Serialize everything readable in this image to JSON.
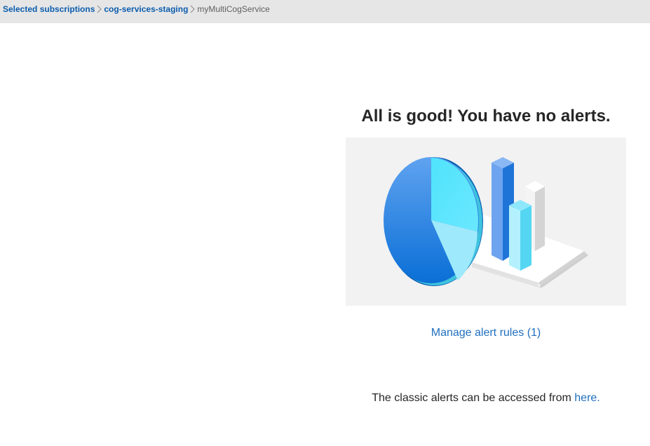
{
  "breadcrumb": {
    "items": [
      "Selected subscriptions",
      "cog-services-staging"
    ],
    "current": "myMultiCogService"
  },
  "main": {
    "headline": "All is good! You have no alerts.",
    "manage_link": "Manage alert rules (1)",
    "classic_text": "The classic alerts can be accessed from ",
    "classic_link": "here."
  },
  "colors": {
    "breadcrumb_bg": "#e6e6e6",
    "link": "#1f6fbf",
    "illustration_bg": "#f2f2f2"
  },
  "icons": {
    "separator": "chevron-right-icon",
    "illustration": "pie-and-bar-chart-illustration"
  }
}
